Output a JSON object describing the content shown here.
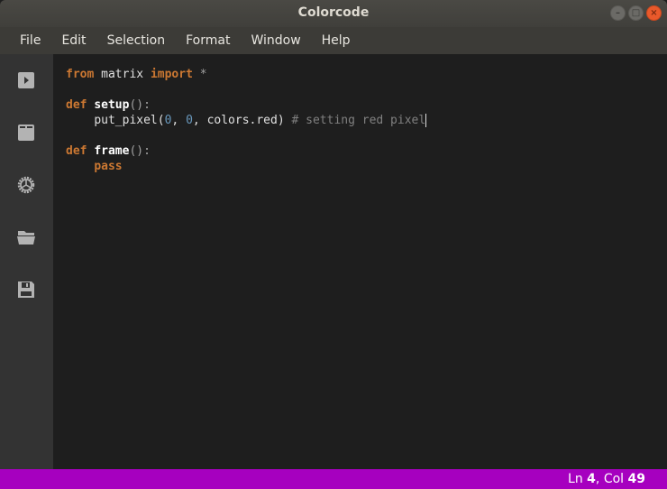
{
  "window": {
    "title": "Colorcode",
    "controls": [
      "minimize",
      "maximize",
      "close"
    ]
  },
  "menu": [
    "File",
    "Edit",
    "Selection",
    "Format",
    "Window",
    "Help"
  ],
  "sidebar": {
    "icons": [
      "run-icon",
      "package-icon",
      "settings-icon",
      "open-folder-icon",
      "save-icon"
    ]
  },
  "editor": {
    "lines": [
      "from matrix import *",
      "",
      "def setup():",
      "    put_pixel(0, 0, colors.red) # setting red pixel",
      "",
      "def frame():",
      "    pass"
    ],
    "tokens": {
      "from": "from",
      "matrix": " matrix ",
      "import": "import",
      "star": " *",
      "def": "def",
      "setup": "setup",
      "parens_colon": "():",
      "indent": "    ",
      "put_pixel": "put_pixel(",
      "zero": "0",
      "comma": ", ",
      "colors_red": "colors.red)",
      "comment": " # setting red pixel",
      "frame": "frame",
      "pass": "pass"
    }
  },
  "status": {
    "ln_label": "Ln",
    "ln": "4",
    "col_label": ", Col",
    "col": "49"
  },
  "colors": {
    "status_bar": "#a600bf",
    "keyword": "#cc7832",
    "number": "#6897bb",
    "comment": "#808080",
    "editor_bg": "#1e1e1e",
    "sidebar_bg": "#333333"
  }
}
